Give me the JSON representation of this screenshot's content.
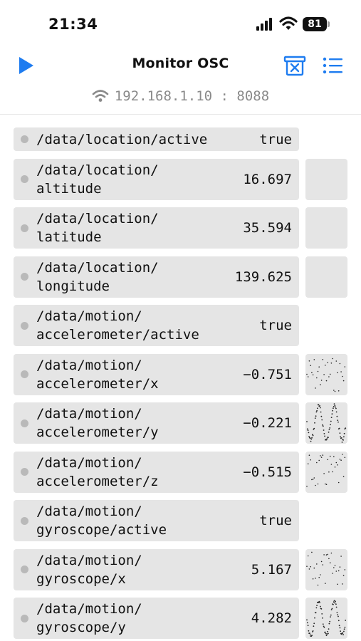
{
  "status_bar": {
    "time": "21:34",
    "battery": "81"
  },
  "header": {
    "title": "Monitor OSC"
  },
  "connection": {
    "address": "192.168.1.10 : 8088"
  },
  "rows": [
    {
      "address": [
        "/data/location/active"
      ],
      "value": "true",
      "thumb": "none"
    },
    {
      "address": [
        "/data/location/",
        "altitude"
      ],
      "value": "16.697",
      "thumb": "empty"
    },
    {
      "address": [
        "/data/location/",
        "latitude"
      ],
      "value": "35.594",
      "thumb": "empty"
    },
    {
      "address": [
        "/data/location/",
        "longitude"
      ],
      "value": "139.625",
      "thumb": "empty"
    },
    {
      "address": [
        "/data/motion/",
        "accelerometer/active"
      ],
      "value": "true",
      "thumb": "none"
    },
    {
      "address": [
        "/data/motion/",
        "accelerometer/x"
      ],
      "value": "−0.751",
      "thumb": "sparse"
    },
    {
      "address": [
        "/data/motion/",
        "accelerometer/y"
      ],
      "value": "−0.221",
      "thumb": "dense"
    },
    {
      "address": [
        "/data/motion/",
        "accelerometer/z"
      ],
      "value": "−0.515",
      "thumb": "sparse"
    },
    {
      "address": [
        "/data/motion/",
        "gyroscope/active"
      ],
      "value": "true",
      "thumb": "none"
    },
    {
      "address": [
        "/data/motion/",
        "gyroscope/x"
      ],
      "value": "5.167",
      "thumb": "sparse"
    },
    {
      "address": [
        "/data/motion/",
        "gyroscope/y"
      ],
      "value": "4.282",
      "thumb": "dense"
    }
  ],
  "colors": {
    "accent": "#1e7cf0",
    "row_bg": "#e5e5e5",
    "dot": "#b9b9b9",
    "muted": "#8a8a8a"
  }
}
